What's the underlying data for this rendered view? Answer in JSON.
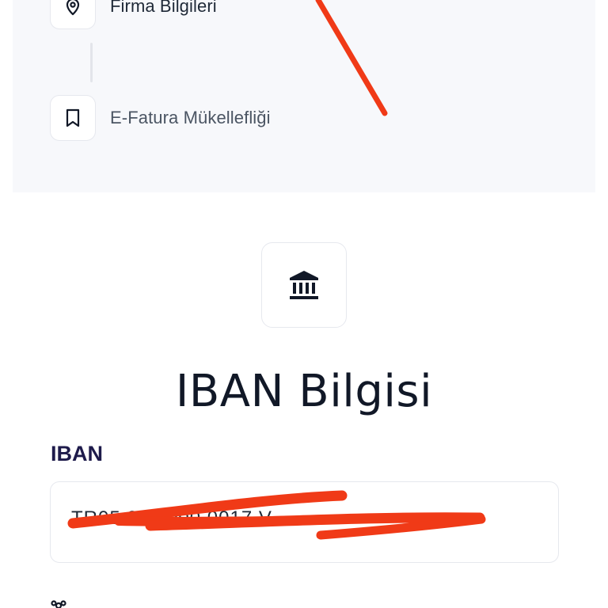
{
  "steps": {
    "items": [
      {
        "label": "Firma Bilgileri",
        "icon": "location-pin-icon"
      },
      {
        "label": "E-Fatura Mükellefliği",
        "icon": "bookmark-icon"
      }
    ]
  },
  "section": {
    "icon": "bank-icon",
    "title": "IBAN Bilgisi"
  },
  "iban": {
    "label": "IBAN",
    "value": "TR05 00           0000 0017 V",
    "redacted": true
  },
  "colors": {
    "panel_bg": "#f7f8fb",
    "label_accent": "#1e1b4b",
    "annotation_red": "#f03a17"
  }
}
